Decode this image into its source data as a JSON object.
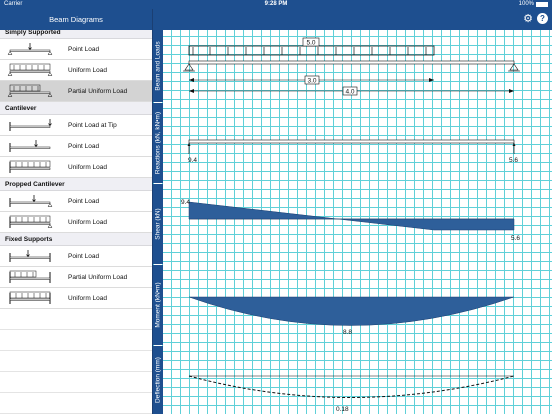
{
  "status_bar": {
    "carrier": "Carrier",
    "time": "9:28 PM",
    "battery": "100%"
  },
  "sidebar": {
    "title": "Beam Diagrams",
    "sections": [
      {
        "title": "Simply Supported",
        "items": [
          "Point Load",
          "Uniform Load",
          "Partial Uniform Load"
        ]
      },
      {
        "title": "Cantilever",
        "items": [
          "Point Load at Tip",
          "Point Load",
          "Uniform Load"
        ]
      },
      {
        "title": "Propped Cantilever",
        "items": [
          "Point Load",
          "Uniform Load"
        ]
      },
      {
        "title": "Fixed Supports",
        "items": [
          "Point Load",
          "Partial Uniform Load",
          "Uniform Load"
        ]
      }
    ],
    "selected": "Partial Uniform Load"
  },
  "toolbar": {
    "settings_icon": "gear-icon",
    "help_label": "?"
  },
  "panels": {
    "beam_label": "Beam and Loads",
    "reactions_label": "Reactions (kN, kN•m)",
    "shear_label": "Shear (kN)",
    "moment_label": "Moment (kN•m)",
    "deflection_label": "Deflection (mm)"
  },
  "beam": {
    "load": "5.0",
    "load_length": "3.0",
    "span": "4.0"
  },
  "reactions": {
    "left": "9.4",
    "right": "5.6"
  },
  "shear": {
    "left": "9.4",
    "right": "5.6"
  },
  "moment": {
    "max": "8.8"
  },
  "deflection": {
    "max": "0.18"
  },
  "colors": {
    "brand": "#1e4f8f",
    "fill": "#2e5f9a",
    "grid": "#5fd0d8"
  }
}
